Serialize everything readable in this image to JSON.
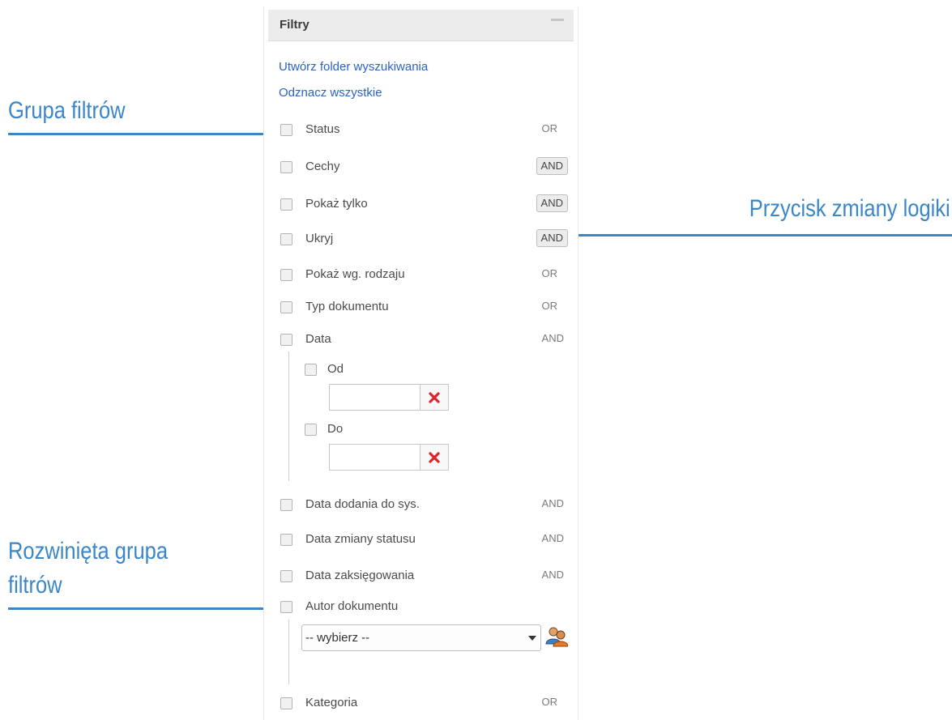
{
  "panel": {
    "title": "Filtry",
    "links": {
      "create_search_folder": "Utwórz folder wyszukiwania",
      "uncheck_all": "Odznacz wszystkie"
    },
    "filters": [
      {
        "label": "Status",
        "logic": "OR",
        "logic_is_button": false
      },
      {
        "label": "Cechy",
        "logic": "AND",
        "logic_is_button": true
      },
      {
        "label": "Pokaż tylko",
        "logic": "AND",
        "logic_is_button": true
      },
      {
        "label": "Ukryj",
        "logic": "AND",
        "logic_is_button": true
      },
      {
        "label": "Pokaż wg. rodzaju",
        "logic": "OR",
        "logic_is_button": false
      },
      {
        "label": "Typ dokumentu",
        "logic": "OR",
        "logic_is_button": false
      },
      {
        "label": "Data",
        "logic": "AND",
        "logic_is_button": false
      },
      {
        "label": "Data dodania do sys.",
        "logic": "AND",
        "logic_is_button": false
      },
      {
        "label": "Data zmiany statusu",
        "logic": "AND",
        "logic_is_button": false
      },
      {
        "label": "Data zaksięgowania",
        "logic": "AND",
        "logic_is_button": false
      },
      {
        "label": "Autor dokumentu",
        "logic": "",
        "logic_is_button": false
      },
      {
        "label": "Kategoria",
        "logic": "OR",
        "logic_is_button": false
      }
    ],
    "date_group": {
      "from_label": "Od",
      "from_value": "",
      "to_label": "Do",
      "to_value": ""
    },
    "author_group": {
      "select_value": "-- wybierz --"
    },
    "icons": {
      "clear": "clear-icon",
      "user_picker": "user-picker-icon",
      "minimize": "minimize-icon"
    }
  },
  "annotations": {
    "filter_group": "Grupa filtrów",
    "logic_button": "Przycisk zmiany logiki",
    "expanded_group_line1": "Rozwinięta grupa",
    "expanded_group_line2": "filtrów"
  },
  "colors": {
    "annotation": "#3a86c8",
    "link": "#2a63c7",
    "clear_icon": "#d9262c"
  }
}
